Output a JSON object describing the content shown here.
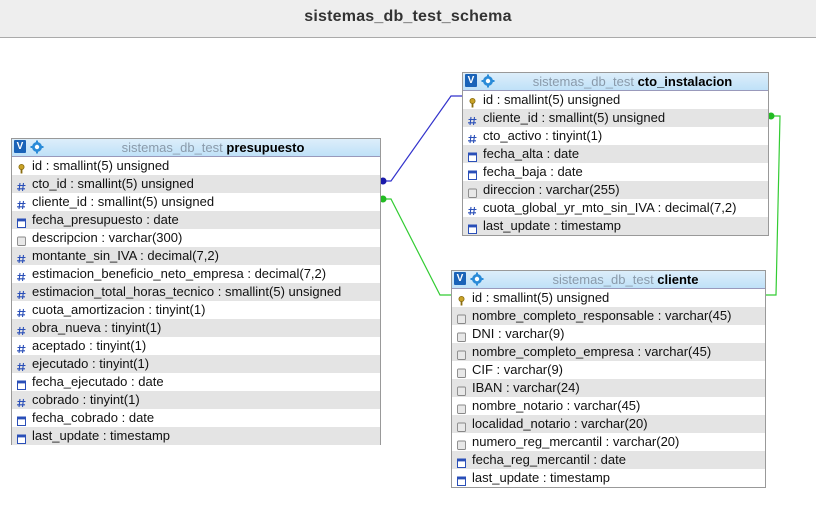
{
  "header": {
    "title": "sistemas_db_test_schema"
  },
  "colors": {
    "link_blue": "#3333cc",
    "link_green": "#33cc33",
    "header_bg": "#bfe1f8"
  },
  "tables": [
    {
      "schema": "sistemas_db_test",
      "name": "presupuesto",
      "columns": [
        {
          "text": "id : smallint(5) unsigned",
          "icon": "key-icon"
        },
        {
          "text": "cto_id : smallint(5) unsigned",
          "icon": "hash-icon"
        },
        {
          "text": "cliente_id : smallint(5) unsigned",
          "icon": "hash-icon"
        },
        {
          "text": "fecha_presupuesto : date",
          "icon": "date-icon"
        },
        {
          "text": "descripcion : varchar(300)",
          "icon": "text-icon"
        },
        {
          "text": "montante_sin_IVA : decimal(7,2)",
          "icon": "hash-icon"
        },
        {
          "text": "estimacion_beneficio_neto_empresa : decimal(7,2)",
          "icon": "hash-icon"
        },
        {
          "text": "estimacion_total_horas_tecnico : smallint(5) unsigned",
          "icon": "hash-icon"
        },
        {
          "text": "cuota_amortizacion : tinyint(1)",
          "icon": "hash-icon"
        },
        {
          "text": "obra_nueva : tinyint(1)",
          "icon": "hash-icon"
        },
        {
          "text": "aceptado : tinyint(1)",
          "icon": "hash-icon"
        },
        {
          "text": "ejecutado : tinyint(1)",
          "icon": "hash-icon"
        },
        {
          "text": "fecha_ejecutado : date",
          "icon": "date-icon"
        },
        {
          "text": "cobrado : tinyint(1)",
          "icon": "hash-icon"
        },
        {
          "text": "fecha_cobrado : date",
          "icon": "date-icon"
        },
        {
          "text": "last_update : timestamp",
          "icon": "date-icon"
        }
      ]
    },
    {
      "schema": "sistemas_db_test",
      "name": "cto_instalacion",
      "columns": [
        {
          "text": "id : smallint(5) unsigned",
          "icon": "key-icon"
        },
        {
          "text": "cliente_id : smallint(5) unsigned",
          "icon": "hash-icon"
        },
        {
          "text": "cto_activo : tinyint(1)",
          "icon": "hash-icon"
        },
        {
          "text": "fecha_alta : date",
          "icon": "date-icon"
        },
        {
          "text": "fecha_baja : date",
          "icon": "date-icon"
        },
        {
          "text": "direccion : varchar(255)",
          "icon": "text-icon"
        },
        {
          "text": "cuota_global_yr_mto_sin_IVA : decimal(7,2)",
          "icon": "hash-icon"
        },
        {
          "text": "last_update : timestamp",
          "icon": "date-icon"
        }
      ]
    },
    {
      "schema": "sistemas_db_test",
      "name": "cliente",
      "columns": [
        {
          "text": "id : smallint(5) unsigned",
          "icon": "key-icon"
        },
        {
          "text": "nombre_completo_responsable : varchar(45)",
          "icon": "text-icon"
        },
        {
          "text": "DNI : varchar(9)",
          "icon": "text-icon"
        },
        {
          "text": "nombre_completo_empresa : varchar(45)",
          "icon": "text-icon"
        },
        {
          "text": "CIF : varchar(9)",
          "icon": "text-icon"
        },
        {
          "text": "IBAN : varchar(24)",
          "icon": "text-icon"
        },
        {
          "text": "nombre_notario : varchar(45)",
          "icon": "text-icon"
        },
        {
          "text": "localidad_notario : varchar(20)",
          "icon": "text-icon"
        },
        {
          "text": "numero_reg_mercantil : varchar(20)",
          "icon": "text-icon"
        },
        {
          "text": "fecha_reg_mercantil : date",
          "icon": "date-icon"
        },
        {
          "text": "last_update : timestamp",
          "icon": "date-icon"
        }
      ]
    }
  ]
}
